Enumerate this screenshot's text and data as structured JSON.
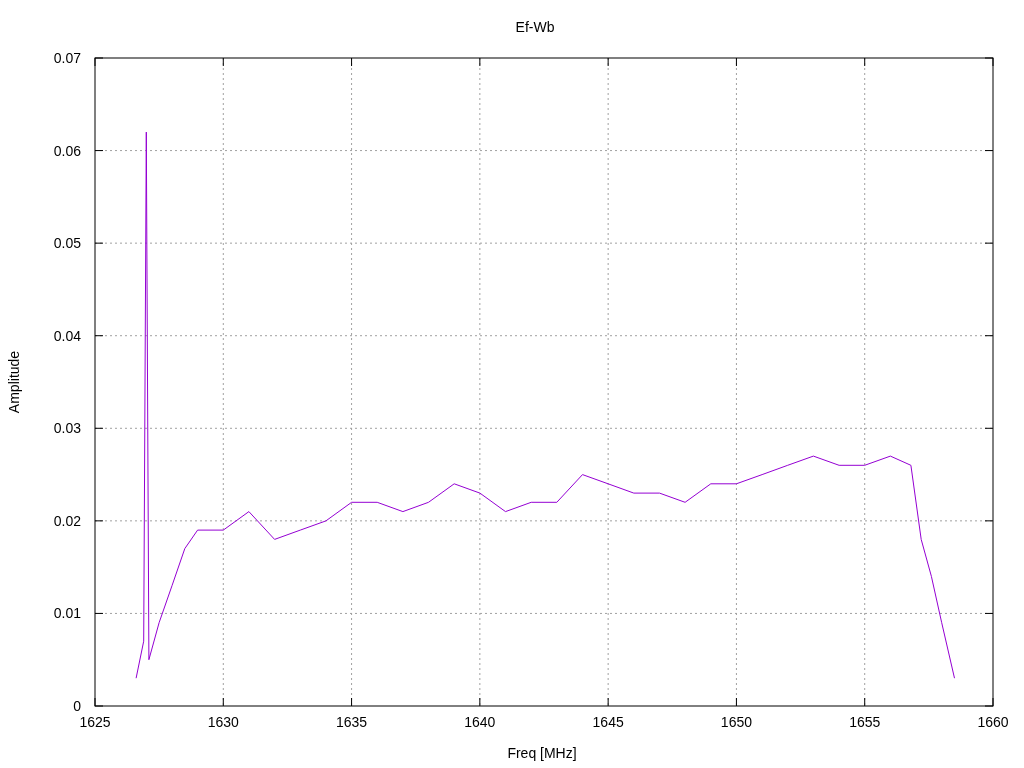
{
  "chart_data": {
    "type": "line",
    "grid": true,
    "title": "Ef-Wb",
    "xlabel": "Freq [MHz]",
    "ylabel": "Amplitude",
    "xlim": [
      1625,
      1660
    ],
    "ylim": [
      0,
      0.07
    ],
    "xticks": [
      1625,
      1630,
      1635,
      1640,
      1645,
      1650,
      1655,
      1660
    ],
    "yticks": [
      {
        "value": 0,
        "label": "0"
      },
      {
        "value": 0.01,
        "label": "0.01"
      },
      {
        "value": 0.02,
        "label": "0.02"
      },
      {
        "value": 0.03,
        "label": "0.03"
      },
      {
        "value": 0.04,
        "label": "0.04"
      },
      {
        "value": 0.05,
        "label": "0.05"
      },
      {
        "value": 0.06,
        "label": "0.06"
      },
      {
        "value": 0.07,
        "label": "0.07"
      }
    ],
    "x": [
      1626.6,
      1626.9,
      1627.0,
      1627.1,
      1627.5,
      1628,
      1628.5,
      1629,
      1630,
      1631,
      1632,
      1633,
      1634,
      1635,
      1636,
      1637,
      1638,
      1639,
      1640,
      1641,
      1642,
      1643,
      1644,
      1645,
      1646,
      1647,
      1648,
      1649,
      1650,
      1651,
      1652,
      1653,
      1654,
      1655,
      1656,
      1656.8,
      1657.2,
      1657.6,
      1658,
      1658.5
    ],
    "series": [
      {
        "color": "#9400d3",
        "values": [
          0.003,
          0.007,
          0.062,
          0.005,
          0.009,
          0.013,
          0.017,
          0.019,
          0.019,
          0.021,
          0.018,
          0.019,
          0.02,
          0.022,
          0.022,
          0.021,
          0.022,
          0.024,
          0.023,
          0.021,
          0.022,
          0.022,
          0.025,
          0.024,
          0.023,
          0.023,
          0.022,
          0.024,
          0.024,
          0.025,
          0.026,
          0.027,
          0.026,
          0.026,
          0.027,
          0.026,
          0.018,
          0.014,
          0.009,
          0.003
        ]
      }
    ]
  }
}
